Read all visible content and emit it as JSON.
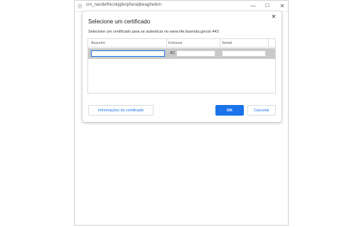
{
  "window": {
    "title": "crx_nacdefhicokjgiknpfanaljkeagheikm",
    "minimize_glyph": "—",
    "maximize_glyph": "☐",
    "close_glyph": "✕"
  },
  "dialog": {
    "title": "Selecione um certificado",
    "description": "Selecione um certificado para se autenticar no www.nfe.fazenda.gov.br:443",
    "close_glyph": "✕",
    "table": {
      "columns": [
        "Assunto",
        "Emissor",
        "Serial"
      ],
      "rows": [
        {
          "assunto": "",
          "emissor_prefix": "AC",
          "emissor": "",
          "serial": ""
        }
      ]
    },
    "buttons": {
      "info_label": "Informações do certificado",
      "ok_label": "OK",
      "cancel_label": "Cancelar"
    }
  },
  "colors": {
    "accent": "#1a73e8",
    "selected_row": "#c9c9c9"
  }
}
